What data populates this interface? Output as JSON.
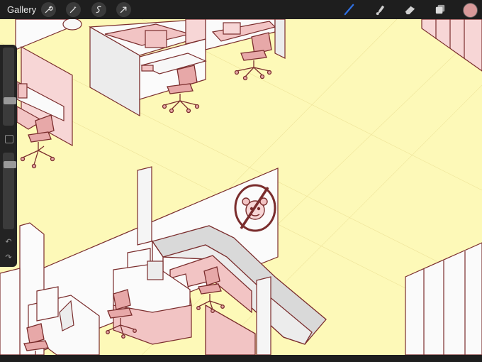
{
  "toolbar": {
    "gallery_label": "Gallery",
    "left_tools": [
      "wrench-icon",
      "magic-wand-icon",
      "selection-icon",
      "transform-arrow-icon"
    ],
    "right_tools": [
      "brush-icon",
      "smudge-icon",
      "eraser-icon",
      "layers-icon"
    ],
    "current_color": "#d89a9a",
    "brush_active_color": "#2f6fe0"
  },
  "sidebar": {
    "brush_size_level": 0.3,
    "opacity_level": 0.88,
    "undo_icon": "undo-icon",
    "redo_icon": "redo-icon"
  },
  "canvas": {
    "background": "#fdf9b8",
    "line_color": "#7a2d2d",
    "fill_pink": "#f2c4c4"
  }
}
